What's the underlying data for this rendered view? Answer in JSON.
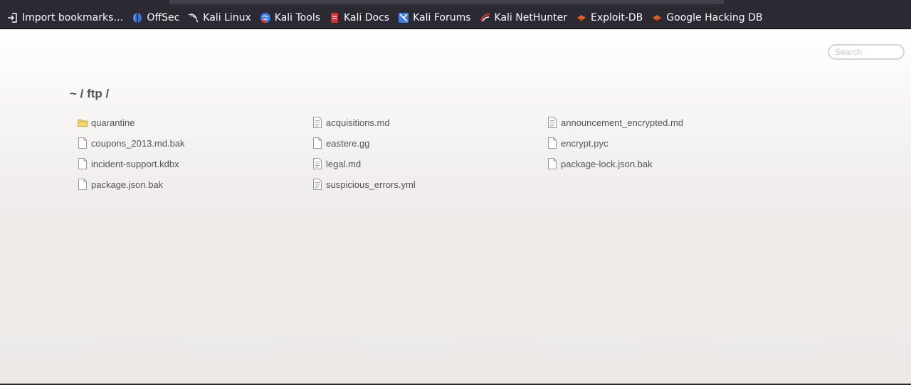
{
  "bookmarks": [
    {
      "label": "Import bookmarks…",
      "icon": "import-icon"
    },
    {
      "label": "OffSec",
      "icon": "offsec-icon"
    },
    {
      "label": "Kali Linux",
      "icon": "kali-dragon-icon"
    },
    {
      "label": "Kali Tools",
      "icon": "kali-tools-icon"
    },
    {
      "label": "Kali Docs",
      "icon": "kali-docs-icon"
    },
    {
      "label": "Kali Forums",
      "icon": "kali-forums-icon"
    },
    {
      "label": "Kali NetHunter",
      "icon": "kali-nethunter-icon"
    },
    {
      "label": "Exploit-DB",
      "icon": "exploit-db-icon"
    },
    {
      "label": "Google Hacking DB",
      "icon": "ghdb-icon"
    }
  ],
  "search": {
    "placeholder": "Search",
    "value": ""
  },
  "breadcrumb": "~ / ftp /",
  "files": [
    {
      "name": "quarantine",
      "kind": "folder"
    },
    {
      "name": "acquisitions.md",
      "kind": "text"
    },
    {
      "name": "announcement_encrypted.md",
      "kind": "text"
    },
    {
      "name": "coupons_2013.md.bak",
      "kind": "blank"
    },
    {
      "name": "eastere.gg",
      "kind": "blank"
    },
    {
      "name": "encrypt.pyc",
      "kind": "blank"
    },
    {
      "name": "incident-support.kdbx",
      "kind": "blank"
    },
    {
      "name": "legal.md",
      "kind": "text"
    },
    {
      "name": "package-lock.json.bak",
      "kind": "blank"
    },
    {
      "name": "package.json.bak",
      "kind": "blank"
    },
    {
      "name": "suspicious_errors.yml",
      "kind": "text"
    }
  ],
  "colors": {
    "toolbar_bg": "#2b2a33",
    "toolbar_text": "#fbfbfe",
    "page_text": "#555555",
    "folder": "#f2c94c",
    "exploit_orange": "#e8611a"
  }
}
